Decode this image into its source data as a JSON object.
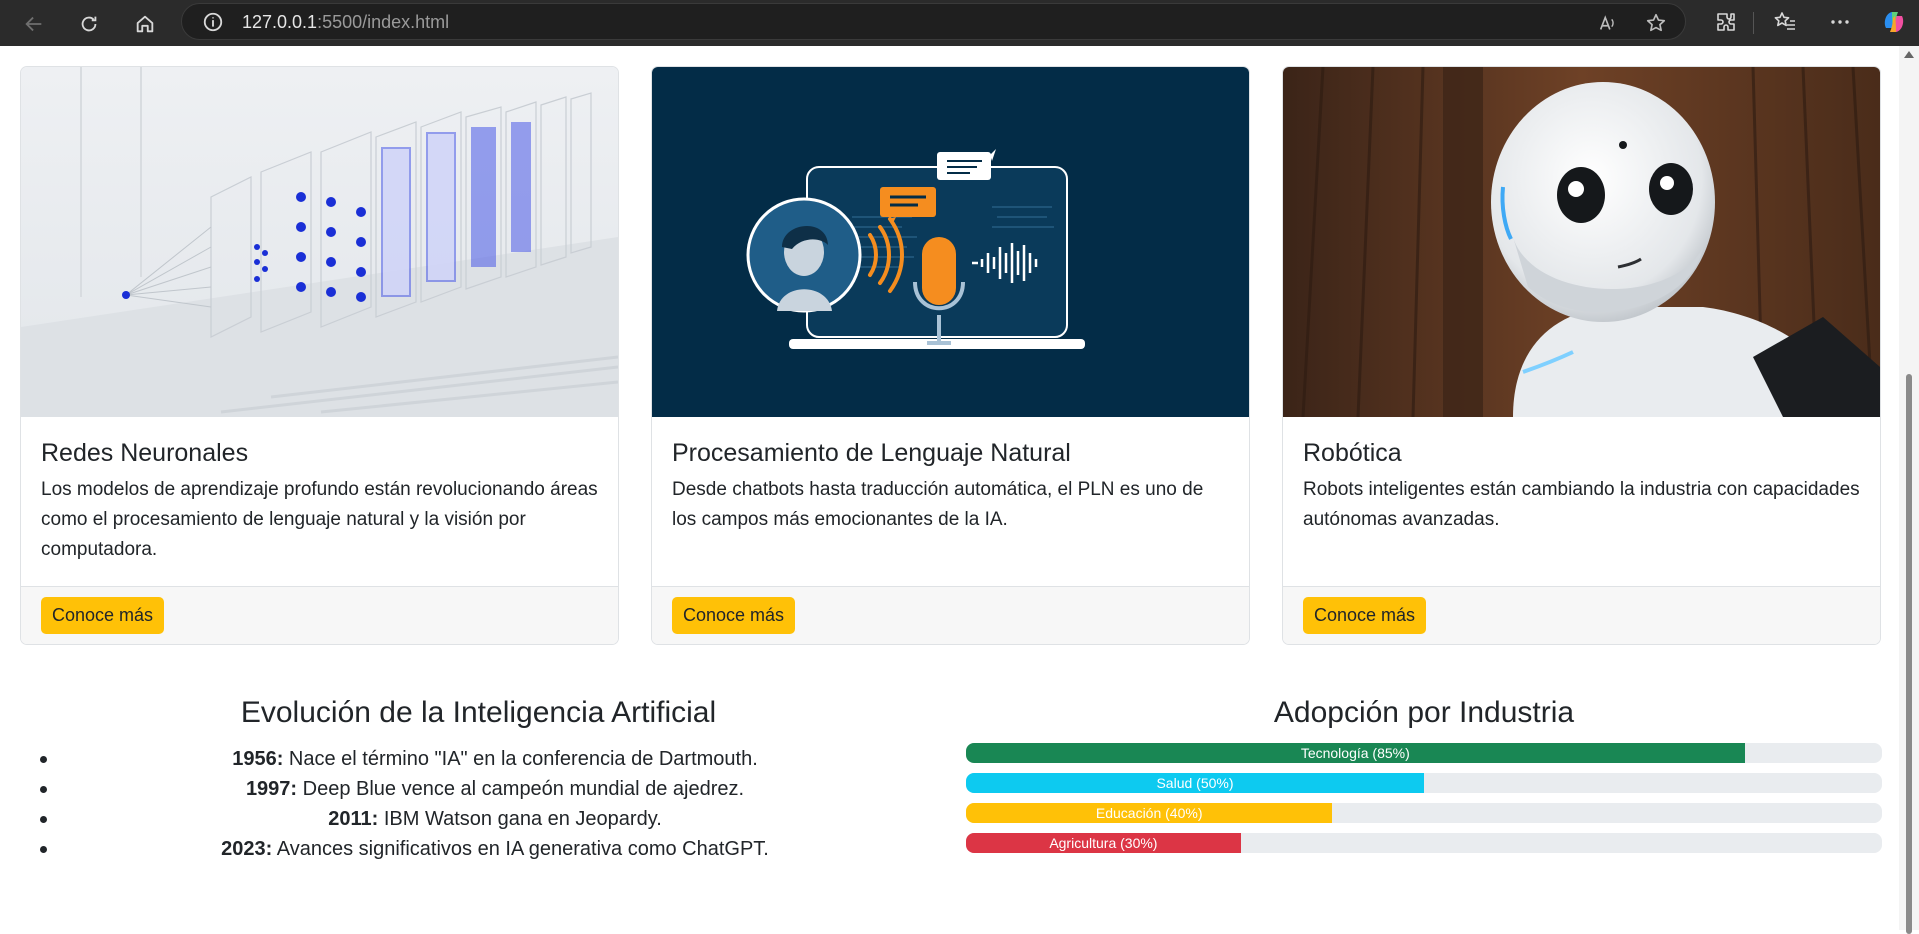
{
  "browser": {
    "url_host": "127.0.0.1",
    "url_path": ":5500/index.html"
  },
  "cards": [
    {
      "title": "Redes Neuronales",
      "text": "Los modelos de aprendizaje profundo están revolucionando áreas como el procesamiento de lenguaje natural y la visión por computadora.",
      "button": "Conoce más",
      "image": "neural-network-illustration"
    },
    {
      "title": "Procesamiento de Lenguaje Natural",
      "text": "Desde chatbots hasta traducción automática, el PLN es uno de los campos más emocionantes de la IA.",
      "button": "Conoce más",
      "image": "nlp-voice-illustration"
    },
    {
      "title": "Robótica",
      "text": "Robots inteligentes están cambiando la industria con capacidades autónomas avanzadas.",
      "button": "Conoce más",
      "image": "humanoid-robot-photo"
    }
  ],
  "timeline": {
    "title": "Evolución de la Inteligencia Artificial",
    "items": [
      {
        "year": "1956:",
        "text": " Nace el término \"IA\" en la conferencia de Dartmouth."
      },
      {
        "year": "1997:",
        "text": " Deep Blue vence al campeón mundial de ajedrez."
      },
      {
        "year": "2011:",
        "text": " IBM Watson gana en Jeopardy."
      },
      {
        "year": "2023:",
        "text": " Avances significativos en IA generativa como ChatGPT."
      }
    ]
  },
  "adoption": {
    "title": "Adopción por Industria",
    "bars": [
      {
        "label": "Tecnología (85%)",
        "percent": 85,
        "color": "#198754"
      },
      {
        "label": "Salud (50%)",
        "percent": 50,
        "color": "#0dcaf0"
      },
      {
        "label": "Educación (40%)",
        "percent": 40,
        "color": "#ffc107"
      },
      {
        "label": "Agricultura (30%)",
        "percent": 30,
        "color": "#dc3545"
      }
    ]
  }
}
